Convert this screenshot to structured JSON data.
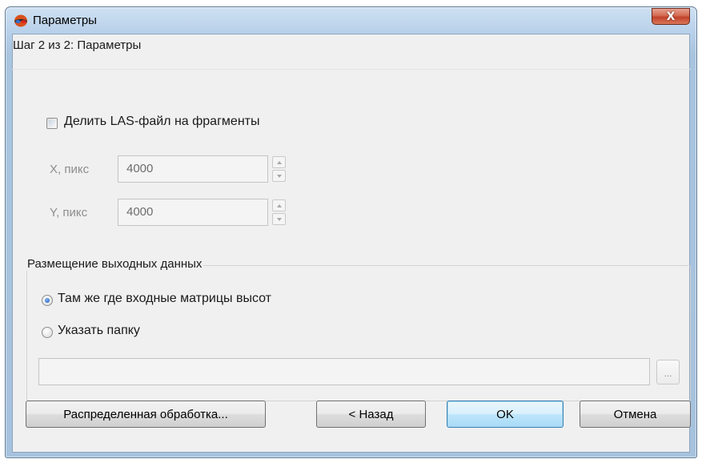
{
  "window": {
    "title": "Параметры",
    "close_label": "X",
    "app_icon": "stereo-glasses-icon"
  },
  "step": {
    "title": "Шаг 2 из 2: Параметры"
  },
  "split": {
    "checkbox_label": "Делить LAS-файл на фрагменты",
    "checked": false,
    "x_label": "X, пикс",
    "x_value": "4000",
    "y_label": "Y, пикс",
    "y_value": "4000"
  },
  "output": {
    "group_title": "Размещение выходных данных",
    "option_same": "Там же где входные матрицы высот",
    "option_folder": "Указать папку",
    "selected": "same",
    "path_value": "",
    "browse_label": "..."
  },
  "buttons": {
    "distributed": "Распределенная обработка...",
    "back": "< Назад",
    "ok": "OK",
    "cancel": "Отмена"
  },
  "colors": {
    "title_bar": "#b9d1ea",
    "close_button": "#c2412a",
    "dialog_bg": "#f0f0f0",
    "radio_selected": "#1c58b8"
  }
}
